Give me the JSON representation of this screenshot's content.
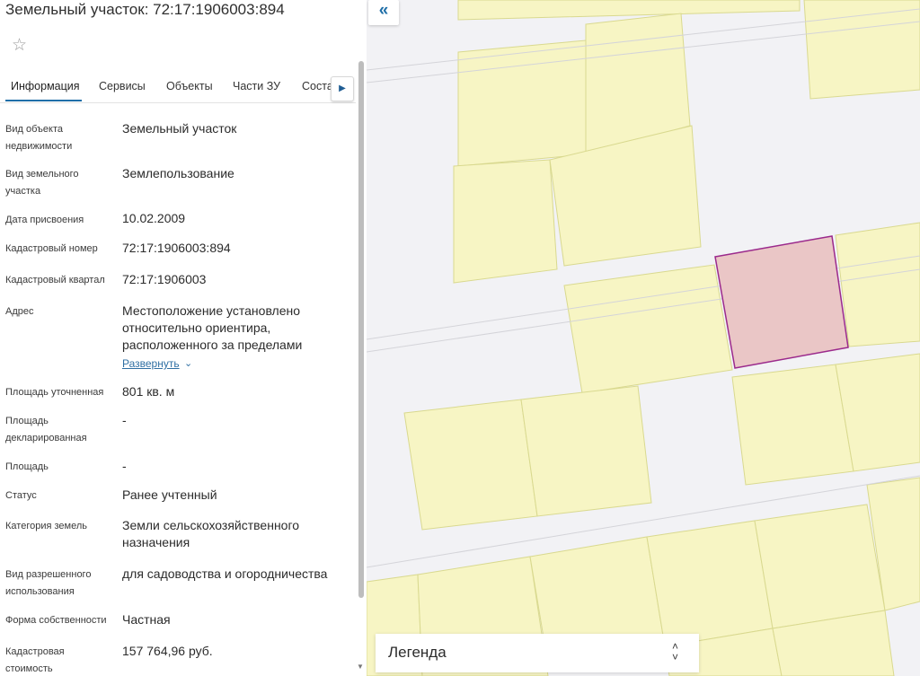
{
  "panel": {
    "title": "Земельный участок: 72:17:1906003:894",
    "star_icon": "star-outline-icon",
    "tabs": [
      {
        "label": "Информация",
        "active": true
      },
      {
        "label": "Сервисы"
      },
      {
        "label": "Объекты"
      },
      {
        "label": "Части ЗУ"
      },
      {
        "label": "Соста"
      }
    ],
    "tabs_next_icon": "chevron-right-icon",
    "fields": [
      {
        "label": "Вид объекта недвижимости",
        "value": "Земельный участок"
      },
      {
        "label": "Вид земельного участка",
        "value": "Землепользование"
      },
      {
        "label": "Дата присвоения",
        "value": "10.02.2009"
      },
      {
        "label": "Кадастровый номер",
        "value": "72:17:1906003:894"
      },
      {
        "label": "Кадастровый квартал",
        "value": "72:17:1906003"
      },
      {
        "label": "Адрес",
        "value": "Местоположение установлено относительно ориентира, расположенного за пределами"
      },
      {
        "label": "Площадь уточненная",
        "value": "801 кв. м"
      },
      {
        "label": "Площадь декларированная",
        "value": "-"
      },
      {
        "label": "Площадь",
        "value": "-"
      },
      {
        "label": "Статус",
        "value": "Ранее учтенный"
      },
      {
        "label": "Категория земель",
        "value": "Земли сельскохозяйственного назначения"
      },
      {
        "label": "Вид разрешенного использования",
        "value": "для садоводства и огородничества"
      },
      {
        "label": "Форма собственности",
        "value": "Частная"
      },
      {
        "label": "Кадастровая стоимость",
        "value": "157 764,96 руб."
      }
    ],
    "expand_link": "Развернуть",
    "expand_icon": "chevron-down-icon"
  },
  "map": {
    "collapse_icon": "double-chevron-left-icon",
    "parcel_fill": "#f7f5c4",
    "parcel_stroke": "#d9d98f",
    "selected_fill": "#eac6c6",
    "selected_stroke": "#9b2a8c",
    "legend_label": "Легенда",
    "legend_toggle_icon": "up-down-chevron-icon"
  }
}
